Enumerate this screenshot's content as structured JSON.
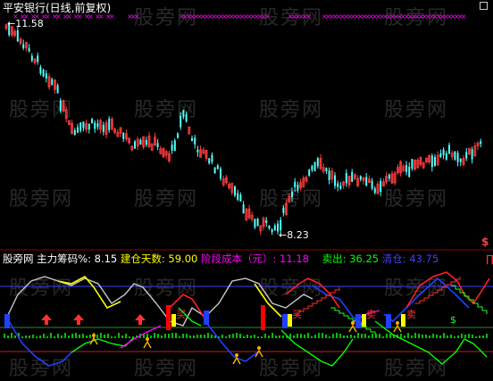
{
  "header": {
    "title": "平安银行(日线,前复权)"
  },
  "price_panel": {
    "high_label": "11.58",
    "low_label": "8.23",
    "dollar_mark": "$"
  },
  "indicator_panel": {
    "name": "股旁网",
    "items": [
      {
        "label": "主力筹码%: ",
        "value": "8.15",
        "color": "#ffffff"
      },
      {
        "label": "建仓天数: ",
        "value": "59.00",
        "color": "#ffff00"
      },
      {
        "label": "阶段成本（元）: ",
        "value": "11.18",
        "color": "#ff00ff"
      },
      {
        "label": "卖出: ",
        "value": "36.25",
        "color": "#00ff00"
      },
      {
        "label": "清仓: ",
        "value": "43.75",
        "color": "#4040ff"
      }
    ],
    "tail_mark": "∏",
    "markers": [
      "买",
      "卖",
      "$"
    ]
  },
  "watermark": "股旁网",
  "colors": {
    "background": "#000000",
    "candle_up": "#ff3c3c",
    "candle_down": "#54ffff",
    "line_gray": "#c8c8c8",
    "line_yellow": "#ffff00",
    "line_blue": "#2040ff",
    "line_green": "#00ff00",
    "line_red": "#ff2020",
    "line_magenta": "#ff00ff",
    "ref_line_red": "#c02020",
    "ref_line_blue": "#4040ff"
  }
}
